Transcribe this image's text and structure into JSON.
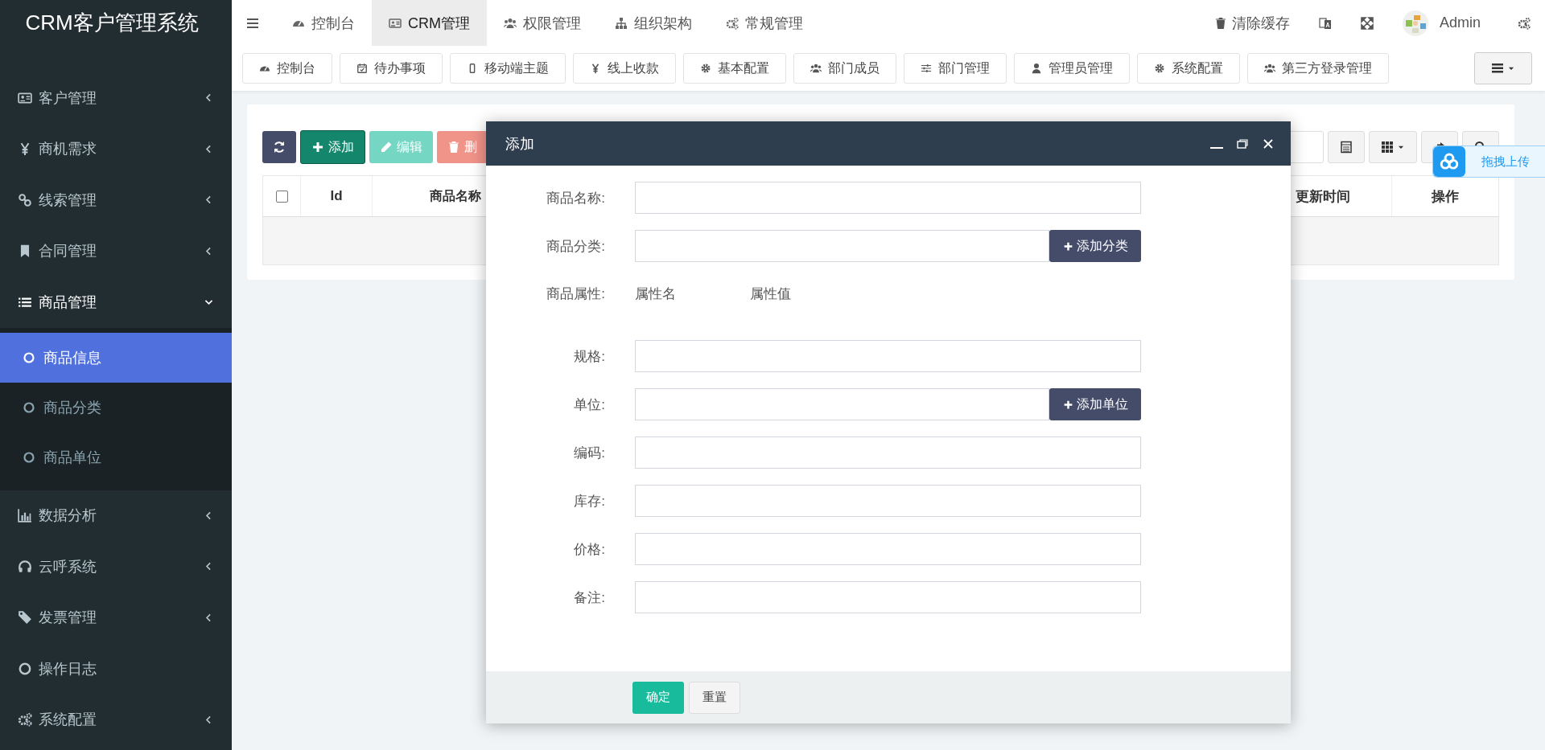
{
  "sidebar": {
    "logo": "CRM客户管理系统",
    "items": [
      {
        "label": "客户管理",
        "kind": "group",
        "expanded": false
      },
      {
        "label": "商机需求",
        "kind": "group",
        "expanded": false
      },
      {
        "label": "线索管理",
        "kind": "group",
        "expanded": false
      },
      {
        "label": "合同管理",
        "kind": "group",
        "expanded": false
      },
      {
        "label": "商品管理",
        "kind": "group",
        "expanded": true,
        "children": [
          {
            "label": "商品信息",
            "selected": true
          },
          {
            "label": "商品分类",
            "selected": false
          },
          {
            "label": "商品单位",
            "selected": false
          }
        ]
      },
      {
        "label": "数据分析",
        "kind": "group",
        "expanded": false
      },
      {
        "label": "云呼系统",
        "kind": "group",
        "expanded": false
      },
      {
        "label": "发票管理",
        "kind": "group",
        "expanded": false
      },
      {
        "label": "操作日志",
        "kind": "link"
      },
      {
        "label": "系统配置",
        "kind": "group",
        "expanded": false
      }
    ]
  },
  "topbar": {
    "tabs": [
      {
        "label": "控制台",
        "selected": false
      },
      {
        "label": "CRM管理",
        "selected": true
      },
      {
        "label": "权限管理",
        "selected": false
      },
      {
        "label": "组织架构",
        "selected": false
      },
      {
        "label": "常规管理",
        "selected": false
      }
    ],
    "clear_cache": "清除缓存",
    "user": "Admin"
  },
  "quick_tabs": [
    "控制台",
    "待办事项",
    "移动端主题",
    "线上收款",
    "基本配置",
    "部门成员",
    "部门管理",
    "管理员管理",
    "系统配置",
    "第三方登录管理"
  ],
  "toolbar": {
    "buttons": [
      {
        "kind": "refresh",
        "disabled": false
      },
      {
        "kind": "add",
        "label": "添加",
        "disabled": false
      },
      {
        "kind": "edit",
        "label": "编辑",
        "disabled": true
      },
      {
        "kind": "delete",
        "label": "删",
        "disabled": true
      }
    ]
  },
  "table": {
    "select_all": {
      "checked": false
    },
    "columns": [
      "Id",
      "商品名称",
      "更新时间",
      "操作"
    ]
  },
  "upload_widget": {
    "label": "拖拽上传"
  },
  "dialog": {
    "title": "添加",
    "fields": [
      {
        "kind": "input",
        "label": "商品名称:"
      },
      {
        "kind": "input_button",
        "label": "商品分类:",
        "button": "添加分类"
      },
      {
        "kind": "attributes",
        "label": "商品属性:",
        "name_header": "属性名",
        "value_header": "属性值"
      },
      {
        "kind": "input",
        "label": "规格:"
      },
      {
        "kind": "input_button",
        "label": "单位:",
        "button": "添加单位"
      },
      {
        "kind": "input",
        "label": "编码:"
      },
      {
        "kind": "input",
        "label": "库存:"
      },
      {
        "kind": "input",
        "label": "价格:"
      },
      {
        "kind": "input",
        "label": "备注:"
      }
    ],
    "buttons": [
      {
        "kind": "primary",
        "label": "确定"
      },
      {
        "kind": "default",
        "label": "重置"
      }
    ]
  }
}
